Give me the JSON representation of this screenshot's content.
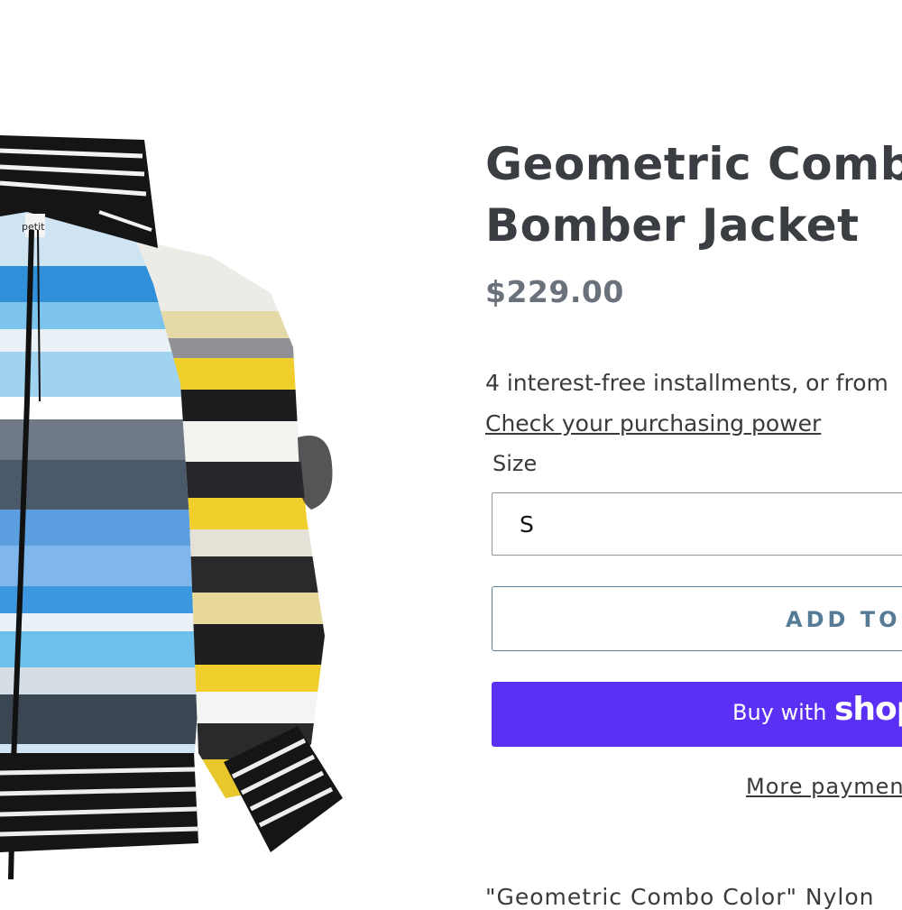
{
  "product": {
    "title_line1": "Geometric Comb",
    "title_line2": "Bomber Jacket",
    "price": "$229.00",
    "installments_text": "4 interest-free installments, or from",
    "purchasing_power_link": "Check your purchasing power",
    "size_label": "Size",
    "size_selected": "S",
    "add_to_cart_label": "ADD TO C",
    "buy_with_label": "Buy with",
    "shop_logo_text": "shop",
    "more_payment_label": "More payment",
    "description_snippet": "\"Geometric Combo Color\"  Nylon",
    "image_brand_tag": "petit"
  },
  "colors": {
    "accent_blue": "#557b97",
    "shop_purple": "#5a31f4",
    "title_text": "#3a3d42",
    "price_text": "#69727b"
  }
}
